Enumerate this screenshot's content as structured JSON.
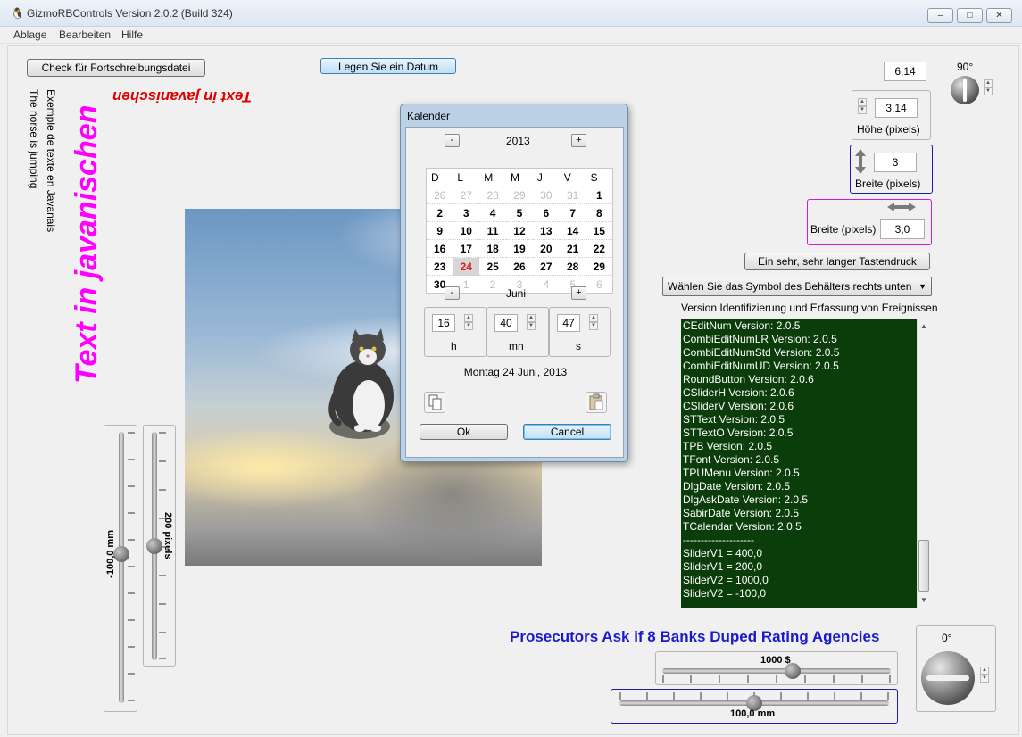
{
  "window": {
    "title": "GizmoRBControls  Version 2.0.2 (Build 324)",
    "app_icon": "penguin-icon",
    "controls": [
      "minimize-icon",
      "maximize-icon",
      "close-icon"
    ]
  },
  "menu": [
    "Ablage",
    "Bearbeiten",
    "Hilfe"
  ],
  "buttons": {
    "check": "Check für Fortschreibungsdatei",
    "set_date": "Legen Sie ein Datum",
    "long_press": "Ein sehr, sehr langer Tastendruck"
  },
  "texts": {
    "horse": "The horse is jumping",
    "exemple": "Exemple de texte en Javanais",
    "javanisch_big": "Text in javanischen",
    "javanisch_flipped": "Text in javanischen",
    "headline": "Prosecutors Ask if 8 Banks Duped Rating Agencies"
  },
  "right_controls": {
    "top_value": "6,14",
    "angle_top": "90°",
    "hoehe_value": "3,14",
    "hoehe_label": "Höhe (pixels)",
    "breite_v_value": "3",
    "breite_v_label": "Breite (pixels)",
    "breite_h_label": "Breite (pixels)",
    "breite_h_value": "3,0",
    "dropdown": "Wählen Sie das Symbol des Behälters rechts unten",
    "log_title": "Version Identifizierung und Erfassung von Ereignissen",
    "angle_bottom": "0°"
  },
  "log_lines": [
    "CEditNum Version: 2.0.5",
    "CombiEditNumLR Version: 2.0.5",
    "CombiEditNumStd Version: 2.0.5",
    "CombiEditNumUD Version: 2.0.5",
    "RoundButton Version: 2.0.6",
    "CSliderH Version: 2.0.6",
    "CSliderV Version: 2.0.6",
    "STText Version: 2.0.5",
    "STTextO Version: 2.0.5",
    "TPB Version: 2.0.5",
    "TFont Version: 2.0.5",
    "TPUMenu Version: 2.0.5",
    "DlgDate Version: 2.0.5",
    "DlgAskDate Version: 2.0.5",
    "SabirDate Version: 2.0.5",
    "TCalendar Version: 2.0.5",
    "--------------------",
    "SliderV1 = 400,0",
    "SliderV1 = 200,0",
    "SliderV2 = 1000,0",
    "SliderV2 = -100,0"
  ],
  "sliders": {
    "v1_label": "-100,0 mm",
    "v1_level": 0.55,
    "v2_label": "200 pixels",
    "v2_level": 0.5,
    "h1_label": "1000 $",
    "h1_level": 0.57,
    "h2_label": "100,0 mm",
    "h2_level": 0.5
  },
  "calendar": {
    "title": "Kalender",
    "year": "2013",
    "month": "Juni",
    "minus": "-",
    "plus": "+",
    "weekdays": [
      "D",
      "L",
      "M",
      "M",
      "J",
      "V",
      "S"
    ],
    "weeks": [
      [
        "26",
        "27",
        "28",
        "29",
        "30",
        "31",
        "1"
      ],
      [
        "2",
        "3",
        "4",
        "5",
        "6",
        "7",
        "8"
      ],
      [
        "9",
        "10",
        "11",
        "12",
        "13",
        "14",
        "15"
      ],
      [
        "16",
        "17",
        "18",
        "19",
        "20",
        "21",
        "22"
      ],
      [
        "23",
        "24",
        "25",
        "26",
        "27",
        "28",
        "29"
      ],
      [
        "30",
        "1",
        "2",
        "3",
        "4",
        "5",
        "6"
      ]
    ],
    "hour": "16",
    "minute": "40",
    "second": "47",
    "h_label": "h",
    "mn_label": "mn",
    "s_label": "s",
    "date_text": "Montag 24 Juni, 2013",
    "ok": "Ok",
    "cancel": "Cancel"
  }
}
